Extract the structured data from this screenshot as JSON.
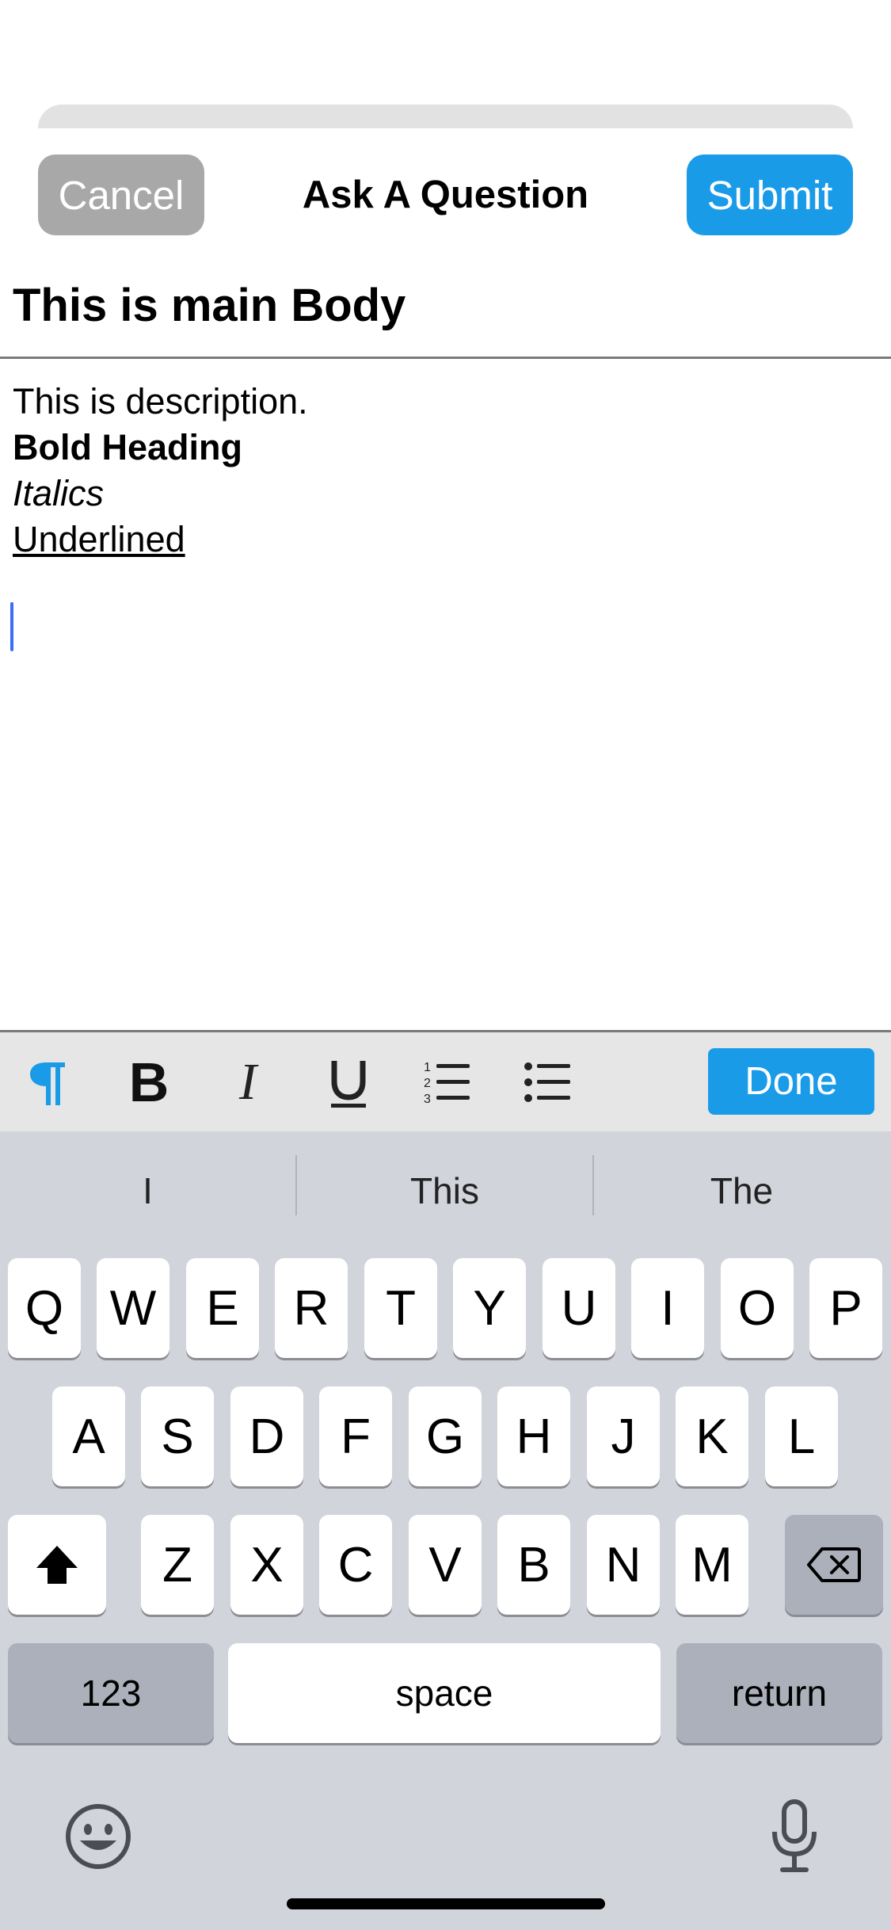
{
  "nav": {
    "cancel_label": "Cancel",
    "title": "Ask A Question",
    "submit_label": "Submit"
  },
  "question": {
    "title": "This is main Body",
    "body": {
      "line1": "This is description.",
      "line2": "Bold Heading",
      "line3": "Italics",
      "line4": "Underlined"
    }
  },
  "toolbar": {
    "icons": [
      "paragraph-icon",
      "bold-icon",
      "italic-icon",
      "underline-icon",
      "numbered-list-icon",
      "bullet-list-icon"
    ],
    "done_label": "Done"
  },
  "keyboard": {
    "suggestions": [
      "I",
      "This",
      "The"
    ],
    "row1": [
      "Q",
      "W",
      "E",
      "R",
      "T",
      "Y",
      "U",
      "I",
      "O",
      "P"
    ],
    "row2": [
      "A",
      "S",
      "D",
      "F",
      "G",
      "H",
      "J",
      "K",
      "L"
    ],
    "row3": [
      "Z",
      "X",
      "C",
      "V",
      "B",
      "N",
      "M"
    ],
    "numbers_label": "123",
    "space_label": "space",
    "return_label": "return"
  },
  "colors": {
    "accent": "#1a9be8",
    "cancel_gray": "#a8a8a8",
    "caret": "#3b6ef5",
    "keyboard_bg": "#d1d4da"
  }
}
